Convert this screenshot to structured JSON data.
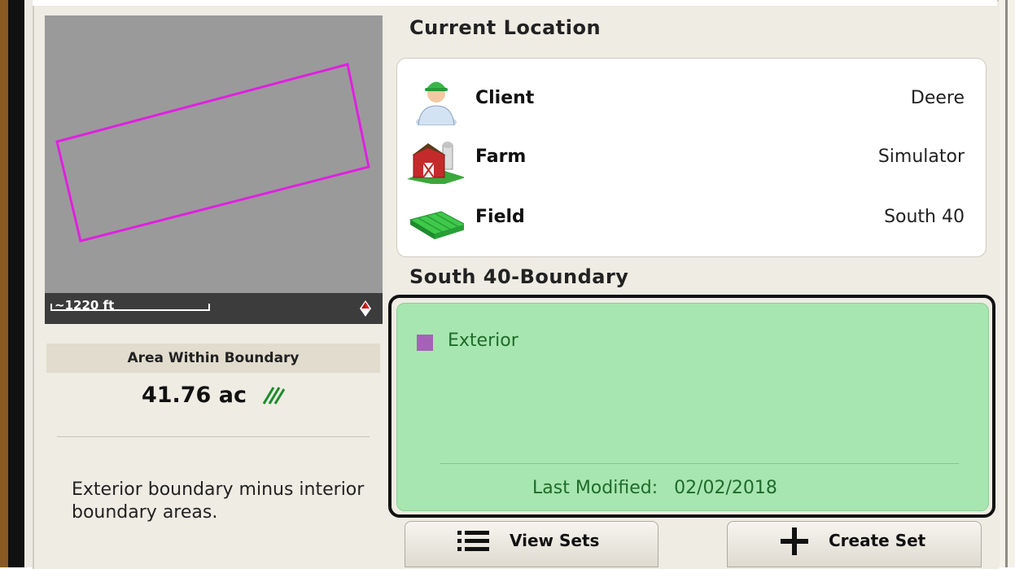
{
  "map": {
    "scale_label": "~1220 ft",
    "boundary_color": "#e020e0",
    "background_color": "#9a9a9a",
    "compass_icon": "compass-north-icon"
  },
  "area": {
    "header": "Area Within Boundary",
    "value": "41.76 ac",
    "value_icon": "hatch-area-icon",
    "description": "Exterior boundary minus interior boundary areas."
  },
  "current_location": {
    "title": "Current Location",
    "rows": [
      {
        "label": "Client",
        "value": "Deere",
        "icon": "client-person-icon"
      },
      {
        "label": "Farm",
        "value": "Simulator",
        "icon": "farm-barn-icon"
      },
      {
        "label": "Field",
        "value": "South 40",
        "icon": "field-icon"
      }
    ]
  },
  "boundary": {
    "title": "South 40-Boundary",
    "items": [
      {
        "label": "Exterior",
        "color": "#a463b5"
      }
    ],
    "last_modified_label": "Last Modified:",
    "last_modified_date": "02/02/2018",
    "selected_color": "#a7e6b0"
  },
  "buttons": {
    "view_sets": "View Sets",
    "create_set": "Create Set"
  }
}
